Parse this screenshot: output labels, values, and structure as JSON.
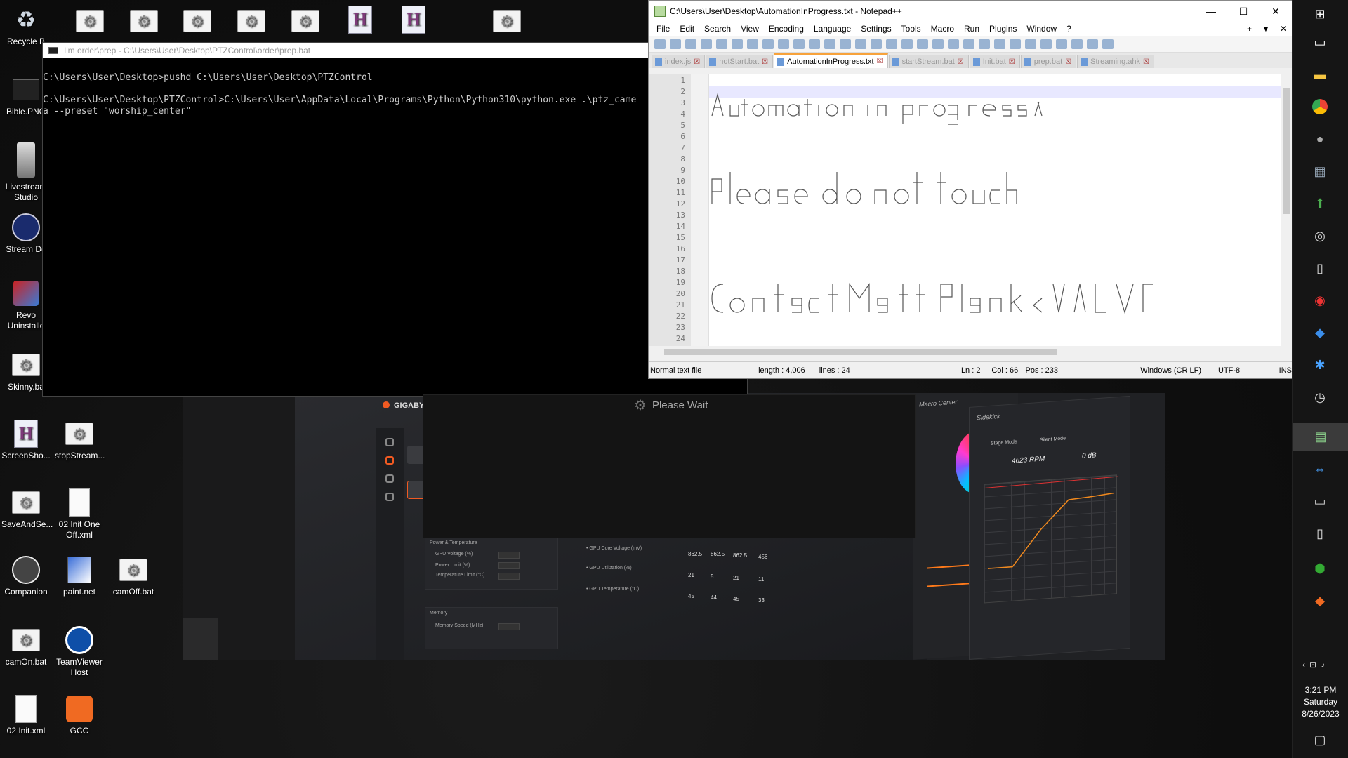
{
  "desktop": {
    "icons": [
      {
        "label": "Recycle B",
        "type": "recycle"
      },
      {
        "label": "Bible.PNG",
        "type": "image"
      },
      {
        "label": "Livestream Studio",
        "type": "app"
      },
      {
        "label": "Stream De",
        "type": "app"
      },
      {
        "label": "Revo Uninstalle",
        "type": "app"
      },
      {
        "label": "Skinny.ba",
        "type": "bat"
      },
      {
        "label": "ScreenSho...",
        "type": "hdoc"
      },
      {
        "label": "stopStream...",
        "type": "bat"
      },
      {
        "label": "SaveAndSe...",
        "type": "bat"
      },
      {
        "label": "02 Init One Off.xml",
        "type": "file"
      },
      {
        "label": "Companion",
        "type": "app"
      },
      {
        "label": "paint.net",
        "type": "app"
      },
      {
        "label": "camOff.bat",
        "type": "bat"
      },
      {
        "label": "camOn.bat",
        "type": "bat"
      },
      {
        "label": "TeamViewer Host",
        "type": "app"
      },
      {
        "label": "02 Init.xml",
        "type": "file"
      },
      {
        "label": "GCC",
        "type": "app"
      }
    ]
  },
  "cmd": {
    "title": "I'm order\\prep - C:\\Users\\User\\Desktop\\PTZControl\\order\\prep.bat",
    "lines": [
      "",
      "C:\\Users\\User\\Desktop>pushd C:\\Users\\User\\Desktop\\PTZControl",
      "",
      "C:\\Users\\User\\Desktop\\PTZControl>C:\\Users\\User\\AppData\\Local\\Programs\\Python\\Python310\\python.exe .\\ptz_came",
      "a --preset \"worship_center\""
    ]
  },
  "please_wait": {
    "text": "Please Wait"
  },
  "gpu_app": {
    "brand": "GIGABYTE",
    "macro_title": "Macro Center",
    "sidekick_title": "Sidekick",
    "stage_mode": "Stage Mode",
    "silent_mode": "Silent Mode",
    "rpm": "4623 RPM",
    "db": "0 dB",
    "power_title": "Power & Temperature",
    "gpu_voltage": "GPU Voltage (%)",
    "power_limit": "Power Limit (%)",
    "temp_limit": "Temperature Limit (°C)",
    "memory_title": "Memory",
    "memory_speed": "Memory Speed (MHz)",
    "core_voltage": "• GPU Core Voltage (mV)",
    "utilization": "• GPU Utilization (%)",
    "temperature": "• GPU Temperature (°C)",
    "row1": [
      "862.5",
      "862.5",
      "862.5",
      "456"
    ],
    "row2": [
      "21",
      "5",
      "21",
      "11"
    ],
    "row3": [
      "45",
      "44",
      "45",
      "33"
    ]
  },
  "notepad": {
    "title": "C:\\Users\\User\\Desktop\\AutomationInProgress.txt - Notepad++",
    "menu": [
      "File",
      "Edit",
      "Search",
      "View",
      "Encoding",
      "Language",
      "Settings",
      "Tools",
      "Macro",
      "Run",
      "Plugins",
      "Window",
      "?"
    ],
    "tabs": [
      {
        "label": "index.js",
        "active": false
      },
      {
        "label": "hotStart.bat",
        "active": false
      },
      {
        "label": "AutomationInProgress.txt",
        "active": true
      },
      {
        "label": "startStream.bat",
        "active": false
      },
      {
        "label": "Init.bat",
        "active": false
      },
      {
        "label": "prep.bat",
        "active": false
      },
      {
        "label": "Streaming.ahk",
        "active": false
      }
    ],
    "line_count": 24,
    "status": {
      "type": "Normal text file",
      "length": "length : 4,006",
      "lines": "lines : 24",
      "ln": "Ln : 2",
      "col": "Col : 66",
      "pos": "Pos : 233",
      "eol": "Windows (CR LF)",
      "encoding": "UTF-8",
      "mode": "INS"
    }
  },
  "taskbar": {
    "time": "3:21 PM",
    "day": "Saturday",
    "date": "8/26/2023"
  }
}
